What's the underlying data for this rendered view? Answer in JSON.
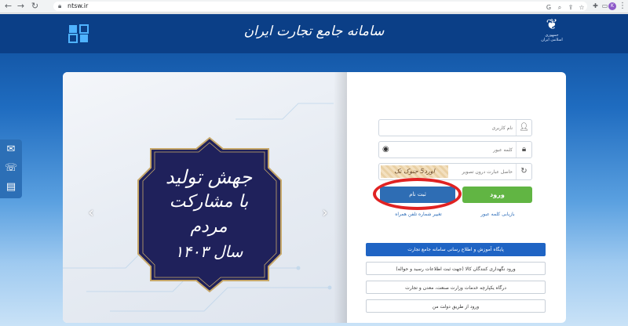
{
  "browser": {
    "url": "ntsw.ir",
    "nav_icons": [
      "back-arrow-icon",
      "forward-arrow-icon",
      "reload-icon"
    ],
    "toolbar_icons": [
      "google-icon",
      "zoom-icon",
      "share-icon",
      "bookmark-star-icon"
    ],
    "extension_icons": [
      "extension-pen-icon",
      "extension-red-icon",
      "extension-grid-icon",
      "extension-puzzle-icon",
      "extension-media-icon",
      "extension-panel-icon"
    ],
    "profile_initial": "K"
  },
  "header": {
    "title": "سامانه جامع تجارت ایران",
    "emblem_text": "جمهوری اسلامی ایران",
    "brand_color": "#0b3f87"
  },
  "sidetools": [
    "mail-icon",
    "phone-help-icon",
    "chat-icon"
  ],
  "hero": {
    "slogan_line1": "جهش تولید",
    "slogan_line2": "با مشارکت مردم",
    "slogan_year": "سال ۱۴۰۳"
  },
  "login": {
    "username_placeholder": "نام کاربری",
    "password_placeholder": "کلمه عبور",
    "captcha_placeholder": "حاصل عبارت درون تصویر",
    "captcha_image_text": "اورد5 جنوک تک",
    "login_label": "ورود",
    "register_label": "ثبت نام",
    "recover_password_link": "بازیابی کلمه عبور",
    "change_phone_link": "تغییر شماره تلفن همراه"
  },
  "info_links": [
    "پایگاه آموزش و اطلاع رسانی سامانه جامع تجارت",
    "ورود نگهداری کنندگان کالا (جهت ثبت اطلاعات رسید و حواله)",
    "درگاه یکپارچه خدمات وزارت صنعت، معدن و تجارت",
    "ورود از طریق دولت من"
  ]
}
